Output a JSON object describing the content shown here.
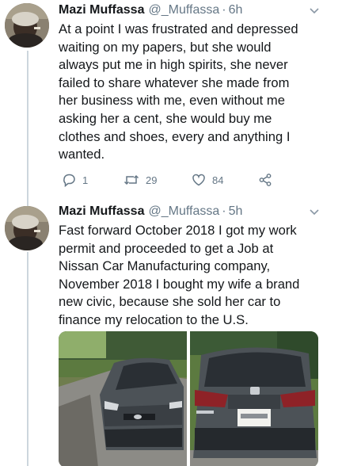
{
  "tweets": [
    {
      "author_name": "Mazi Muffassa",
      "handle": "@_Muffassa",
      "separator": "·",
      "time": "6h",
      "text": "At a point I was frustrated and depressed\nwaiting on my papers, but she would\nalways put me in high spirits, she never\nfailed to share whatever she made from\nher business with me, even without me\nasking her a cent, she would buy me\nclothes and shoes, every and anything I\nwanted.",
      "reply_count": "1",
      "retweet_count": "29",
      "like_count": "84"
    },
    {
      "author_name": "Mazi Muffassa",
      "handle": "@_Muffassa",
      "separator": "·",
      "time": "5h",
      "text": "Fast forward October 2018 I got my work\npermit and proceeded to get a Job at\nNissan Car Manufacturing company,\nNovember 2018 I bought my wife a brand\nnew civic, because she sold her car to\nfinance my relocation to the U.S.",
      "media": [
        "front-of-civic-photo",
        "rear-of-civic-photo"
      ]
    }
  ],
  "colors": {
    "text": "#14171a",
    "secondary": "#657786",
    "thread_line": "#ccd6dd",
    "car_gray": "#4c5257"
  },
  "icons": [
    "chevron-down-icon",
    "reply-icon",
    "retweet-icon",
    "like-icon",
    "share-icon"
  ]
}
